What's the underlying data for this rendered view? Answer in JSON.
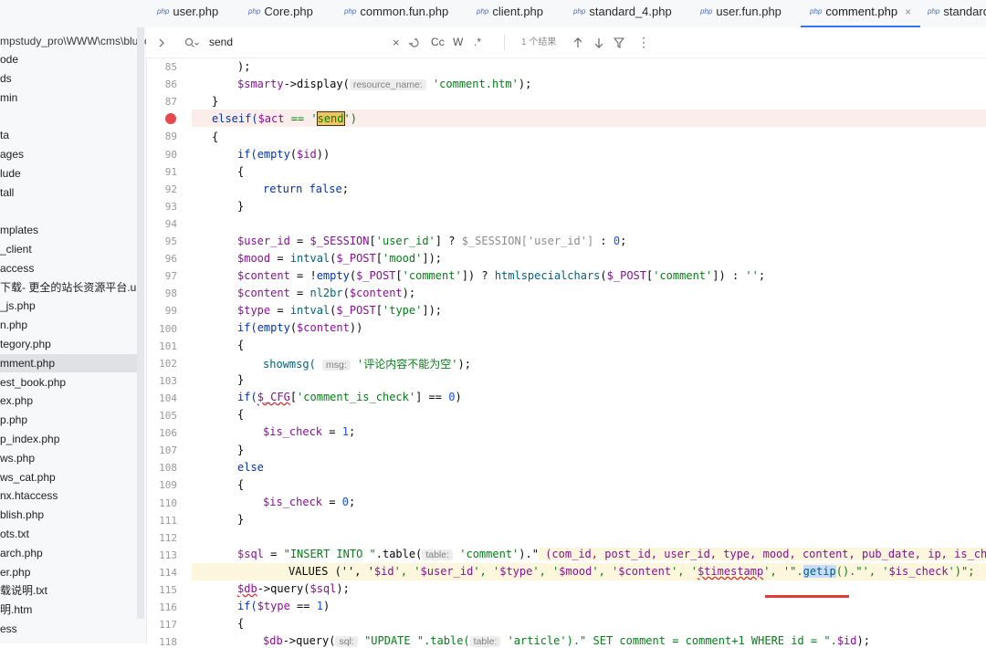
{
  "sidebar": {
    "path": "mpstudy_pro\\WWW\\cms\\bluec",
    "items": [
      "ode",
      "ds",
      "min",
      "",
      "ta",
      "ages",
      "lude",
      "tall",
      "",
      "mplates",
      "_client",
      "access",
      "下载- 更全的站长资源平台.url",
      "_js.php",
      "n.php",
      "tegory.php",
      "mment.php",
      "est_book.php",
      "ex.php",
      "p.php",
      "p_index.php",
      "ws.php",
      "ws_cat.php",
      "nx.htaccess",
      "blish.php",
      "ots.txt",
      "arch.php",
      "er.php",
      "载说明.txt",
      "明.htm",
      "ess"
    ],
    "selected_index": 16
  },
  "tabs": [
    {
      "label": "user.php",
      "active": false
    },
    {
      "label": "Core.php",
      "active": false
    },
    {
      "label": "common.fun.php",
      "active": false
    },
    {
      "label": "client.php",
      "active": false
    },
    {
      "label": "standard_4.php",
      "active": false
    },
    {
      "label": "user.fun.php",
      "active": false
    },
    {
      "label": "comment.php",
      "active": true
    },
    {
      "label": "standard",
      "active": false
    }
  ],
  "tab_icon_text": "php",
  "tab_close_glyph": "×",
  "search": {
    "query": "send",
    "result_text": "1 个结果",
    "options": {
      "case": "Cc",
      "word": "W",
      "regex": ".*"
    }
  },
  "editor": {
    "hints": {
      "resource_name": "resource_name:",
      "msg": "msg:",
      "table": "table:",
      "sql": "sql:"
    },
    "lines": [
      {
        "n": "85"
      },
      {
        "n": "86"
      },
      {
        "n": "87"
      },
      {
        "n": "88"
      },
      {
        "n": "89"
      },
      {
        "n": "90"
      },
      {
        "n": "91"
      },
      {
        "n": "92"
      },
      {
        "n": "93"
      },
      {
        "n": "94"
      },
      {
        "n": "95"
      },
      {
        "n": "96"
      },
      {
        "n": "97"
      },
      {
        "n": "98"
      },
      {
        "n": "99"
      },
      {
        "n": "100"
      },
      {
        "n": "101"
      },
      {
        "n": "102"
      },
      {
        "n": "103"
      },
      {
        "n": "104"
      },
      {
        "n": "105"
      },
      {
        "n": "106"
      },
      {
        "n": "107"
      },
      {
        "n": "108"
      },
      {
        "n": "109"
      },
      {
        "n": "110"
      },
      {
        "n": "111"
      },
      {
        "n": "112"
      },
      {
        "n": "113"
      },
      {
        "n": "114"
      },
      {
        "n": "115"
      },
      {
        "n": "116"
      },
      {
        "n": "117"
      },
      {
        "n": "118"
      }
    ],
    "text": {
      "l85": ");",
      "l86a": "$smarty",
      "l86b": "->display(",
      "l86c": "'comment.htm'",
      "l86d": ");",
      "l87": "}",
      "l88a": "elseif(",
      "l88b": "$act",
      "l88c": " == '",
      "l88d": "send",
      "l88e": "')",
      "l89": "{",
      "l90a": "if(",
      "l90b": "empty",
      "l90c": "(",
      "l90d": "$id",
      "l90e": "))",
      "l91": "{",
      "l92a": "return ",
      "l92b": "false",
      "l92c": ";",
      "l93": "}",
      "l95a": "$user_id",
      "l95b": " = ",
      "l95c": "$_SESSION",
      "l95d": "[",
      "l95e": "'user_id'",
      "l95f": "] ? ",
      "l95g": "$_SESSION",
      "l95h": "['user_id']",
      "l95i": " : ",
      "l95j": "0",
      "l95k": ";",
      "l96a": "$mood",
      "l96b": " = ",
      "l96c": "intval",
      "l96d": "(",
      "l96e": "$_POST",
      "l96f": "[",
      "l96g": "'mood'",
      "l96h": "]);",
      "l97a": "$content",
      "l97b": " = !",
      "l97c": "empty",
      "l97d": "(",
      "l97e": "$_POST",
      "l97f": "[",
      "l97g": "'comment'",
      "l97h": "]) ? ",
      "l97i": "htmlspecialchars",
      "l97j": "(",
      "l97k": "$_POST",
      "l97l": "[",
      "l97m": "'comment'",
      "l97n": "]) : ",
      "l97o": "''",
      "l97p": ";",
      "l98a": "$content",
      "l98b": " = ",
      "l98c": "nl2br",
      "l98d": "(",
      "l98e": "$content",
      "l98f": ");",
      "l99a": "$type",
      "l99b": " = ",
      "l99c": "intval",
      "l99d": "(",
      "l99e": "$_POST",
      "l99f": "[",
      "l99g": "'type'",
      "l99h": "]);",
      "l100a": "if(",
      "l100b": "empty",
      "l100c": "(",
      "l100d": "$content",
      "l100e": "))",
      "l101": "{",
      "l102a": "showmsg(",
      "l102b": "'评论内容不能为空'",
      "l102c": ");",
      "l103": "}",
      "l104a": "if(",
      "l104b": "$_CFG",
      "l104c": "[",
      "l104d": "'comment_is_check'",
      "l104e": "] == ",
      "l104f": "0",
      "l104g": ")",
      "l105": "{",
      "l106a": "$is_check",
      "l106b": " = ",
      "l106c": "1",
      "l106d": ";",
      "l107": "}",
      "l108": "else",
      "l109": "{",
      "l110a": "$is_check",
      "l110b": " = ",
      "l110c": "0",
      "l110d": ";",
      "l111": "}",
      "l113a": "$sql",
      "l113b": " = ",
      "l113c": "\"INSERT INTO \"",
      "l113d": ".table(",
      "l113e": "'comment'",
      "l113f": ").\"",
      "l113g": " (com_id, post_id, user_id, type, mood, content, pub_date, ip, is_check)",
      "l114a": "VALUES ('', '",
      "l114b": "$id",
      "l114c": "', '",
      "l114d": "$user_id",
      "l114e": "', '",
      "l114f": "$type",
      "l114g": "', '",
      "l114h": "$mood",
      "l114i": "', '",
      "l114j": "$content",
      "l114k": "', '",
      "l114l": "$timestamp",
      "l114m": "', '\".",
      "l114n": "getip",
      "l114o": "().\"', '",
      "l114p": "$is_check",
      "l114q": "')\";",
      "l115a": "$db",
      "l115b": "->query(",
      "l115c": "$sql",
      "l115d": ");",
      "l116a": "if(",
      "l116b": "$type",
      "l116c": " == ",
      "l116d": "1",
      "l116e": ")",
      "l117": "{",
      "l118a": "$db",
      "l118b": "->query(",
      "l118c": "\"UPDATE \".table(",
      "l118d": "'article'",
      "l118e": ").\" SET comment = comment+1 WHERE id = \".",
      "l118f": "$id",
      "l118g": ");"
    }
  },
  "colors": {
    "breakpoint": "#e5484d",
    "breakpoint_row": "#fbeeea",
    "current_row": "#fcf7dc",
    "accent": "#3574f0",
    "annotation_underline": "#e53935"
  },
  "icons": [
    "chevron-right-icon",
    "search-icon",
    "clear-icon",
    "replace-icon",
    "arrow-up-icon",
    "arrow-down-icon",
    "filter-icon",
    "more-icon",
    "breakpoint-icon"
  ]
}
